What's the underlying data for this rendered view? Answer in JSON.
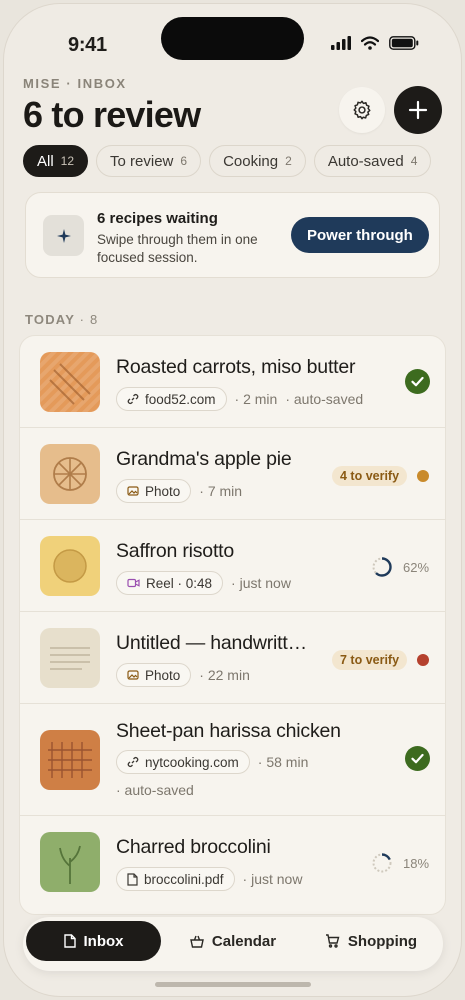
{
  "status_bar": {
    "time": "9:41"
  },
  "header": {
    "eyebrow": "MISE · INBOX",
    "title": "6 to review",
    "settings_icon": "gear-icon",
    "add_icon": "plus-icon"
  },
  "filters": [
    {
      "label": "All",
      "count": "12",
      "active": true
    },
    {
      "label": "To review",
      "count": "6",
      "active": false
    },
    {
      "label": "Cooking",
      "count": "2",
      "active": false
    },
    {
      "label": "Auto-saved",
      "count": "4",
      "active": false
    }
  ],
  "banner": {
    "icon": "sparkle-icon",
    "title": "6 recipes waiting",
    "subtitle": "Swipe through them in one focused session.",
    "button": "Power through"
  },
  "section": {
    "label": "TODAY",
    "count": "· 8"
  },
  "recipes": [
    {
      "title": "Roasted carrots, miso butter",
      "source_icon": "link-icon",
      "source": "food52.com",
      "time": "· 2 min",
      "extra": "· auto-saved",
      "status": "saved",
      "status_color": "#3d6b1f",
      "thumb_color": "#e49a5a"
    },
    {
      "title": "Grandma's apple pie",
      "source_icon": "photo-icon",
      "source": "Photo",
      "time": "· 7 min",
      "status": "verify",
      "verify_label": "4 to verify",
      "dot_color": "#c98a2b",
      "thumb_color": "#e6bd8c"
    },
    {
      "title": "Saffron risotto",
      "source_icon": "video-icon",
      "source": "Reel · 0:48",
      "time": "· just now",
      "status": "progress",
      "progress": 62,
      "progress_label": "62%",
      "thumb_color": "#f0d17a"
    },
    {
      "title": "Untitled — handwritt…",
      "source_icon": "photo-icon",
      "source": "Photo",
      "time": "· 22 min",
      "status": "verify",
      "verify_label": "7 to verify",
      "dot_color": "#b5412e",
      "thumb_color": "#e7dfcc"
    },
    {
      "title": "Sheet-pan harissa chicken",
      "source_icon": "link-icon",
      "source": "nytcooking.com",
      "time": "· 58 min",
      "extra": "· auto-saved",
      "status": "saved",
      "status_color": "#3d6b1f",
      "thumb_color": "#cf7f45"
    },
    {
      "title": "Charred broccolini",
      "source_icon": "document-icon",
      "source": "broccolini.pdf",
      "time": "· just now",
      "status": "progress",
      "progress": 18,
      "progress_label": "18%",
      "thumb_color": "#8fae6b"
    }
  ],
  "tabs": [
    {
      "label": "Inbox",
      "icon": "document-icon",
      "active": true
    },
    {
      "label": "Calendar",
      "icon": "basket-icon",
      "active": false
    },
    {
      "label": "Shopping",
      "icon": "cart-icon",
      "active": false
    }
  ]
}
